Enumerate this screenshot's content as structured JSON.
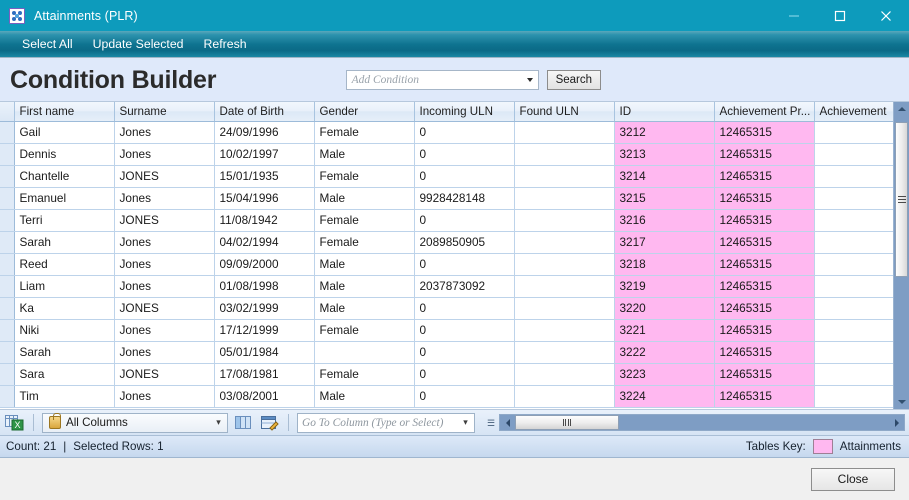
{
  "window": {
    "title": "Attainments (PLR)",
    "icon": "app-dots-icon",
    "minimize_label": "─",
    "maximize_label": "□",
    "close_label": "✕"
  },
  "menu": {
    "items": [
      {
        "label": "Select All"
      },
      {
        "label": "Update Selected"
      },
      {
        "label": "Refresh"
      }
    ]
  },
  "header": {
    "title": "Condition Builder",
    "condition_combo": {
      "placeholder": "Add Condition",
      "value": ""
    },
    "search_label": "Search"
  },
  "grid": {
    "columns": [
      "First name",
      "Surname",
      "Date of Birth",
      "Gender",
      "Incoming ULN",
      "Found ULN",
      "ID",
      "Achievement Pr...",
      "Achievement"
    ],
    "highlight_columns": [
      6,
      7
    ],
    "highlight_color": "#ffb8f0",
    "rows": [
      [
        "Gail",
        "Jones",
        "24/09/1996",
        "Female",
        "0",
        "",
        "3212",
        "12465315",
        ""
      ],
      [
        "Dennis",
        "Jones",
        "10/02/1997",
        "Male",
        "0",
        "",
        "3213",
        "12465315",
        ""
      ],
      [
        "Chantelle",
        "JONES",
        "15/01/1935",
        "Female",
        "0",
        "",
        "3214",
        "12465315",
        ""
      ],
      [
        "Emanuel",
        "Jones",
        "15/04/1996",
        "Male",
        "9928428148",
        "",
        "3215",
        "12465315",
        ""
      ],
      [
        "Terri",
        "JONES",
        "11/08/1942",
        "Female",
        "0",
        "",
        "3216",
        "12465315",
        ""
      ],
      [
        "Sarah",
        "Jones",
        "04/02/1994",
        "Female",
        "2089850905",
        "",
        "3217",
        "12465315",
        ""
      ],
      [
        "Reed",
        "Jones",
        "09/09/2000",
        "Male",
        "0",
        "",
        "3218",
        "12465315",
        ""
      ],
      [
        "Liam",
        "Jones",
        "01/08/1998",
        "Male",
        "2037873092",
        "",
        "3219",
        "12465315",
        ""
      ],
      [
        "Ka",
        "JONES",
        "03/02/1999",
        "Male",
        "0",
        "",
        "3220",
        "12465315",
        ""
      ],
      [
        "Niki",
        "Jones",
        "17/12/1999",
        "Female",
        "0",
        "",
        "3221",
        "12465315",
        ""
      ],
      [
        "Sarah",
        "Jones",
        "05/01/1984",
        "",
        "0",
        "",
        "3222",
        "12465315",
        ""
      ],
      [
        "Sara",
        "JONES",
        "17/08/1981",
        "Female",
        "0",
        "",
        "3223",
        "12465315",
        ""
      ],
      [
        "Tim",
        "Jones",
        "03/08/2001",
        "Male",
        "0",
        "",
        "3224",
        "12465315",
        ""
      ]
    ]
  },
  "toolbar": {
    "export_icon": "export-to-excel-icon",
    "columns_combo": {
      "value": "All Columns",
      "lock_icon": "lock-icon"
    },
    "copy_icon": "copy-layout-icon",
    "edit_icon": "edit-layout-icon",
    "goto_combo": {
      "placeholder": "Go To Column (Type or Select)",
      "value": ""
    }
  },
  "status": {
    "count_label": "Count: 21",
    "separator": "|",
    "selected_label": "Selected Rows: 1",
    "tables_key_label": "Tables Key:",
    "tables_key_value": "Attainments",
    "tables_key_color": "#ffb8f0"
  },
  "footer": {
    "close_label": "Close"
  }
}
